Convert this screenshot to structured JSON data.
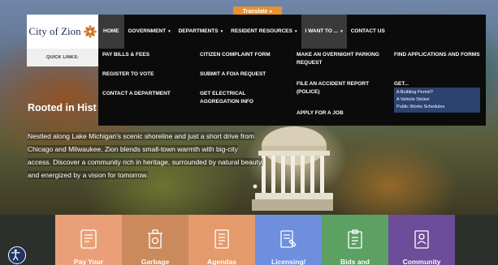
{
  "translate": {
    "label": "Translate »"
  },
  "logo": {
    "text": "City of Zion"
  },
  "quick_links": {
    "label": "QUICK LINKS:"
  },
  "nav": {
    "items": [
      {
        "label": "HOME",
        "caret": ""
      },
      {
        "label": "GOVERNMENT",
        "caret": "▾"
      },
      {
        "label": "DEPARTMENTS",
        "caret": "▾"
      },
      {
        "label": "RESIDENT RESOURCES",
        "caret": "▾"
      },
      {
        "label": "I WANT TO ...",
        "caret": "▾"
      },
      {
        "label": "CONTACT US",
        "caret": ""
      }
    ]
  },
  "dropdown": {
    "col1": [
      "PAY BILLS & FEES",
      "REGISTER TO VOTE",
      "CONTACT A DEPARTMENT"
    ],
    "col2": [
      "CITIZEN COMPLAINT FORM",
      "SUBMIT A FOIA REQUEST",
      "GET ELECTRICAL AGGREGATION INFO"
    ],
    "col3": [
      "MAKE AN OVERNIGHT PARKING REQUEST",
      "FILE AN ACCIDENT REPORT (POLICE)",
      "APPLY FOR A JOB"
    ],
    "col4": [
      "FIND APPLICATIONS AND FORMS",
      "GET..."
    ],
    "get_list": [
      "A Building Permit?",
      "A Vehicle Sticker",
      "Public Works Schedules"
    ]
  },
  "hero": {
    "title": "Rooted in Hist",
    "body": "Nestled along Lake Michigan's scenic shoreline and just a short drive from Chicago and Milwaukee, Zion blends small-town warmth with big-city access. Discover a community rich in heritage, surrounded by natural beauty, and energized by a vision for tomorrow."
  },
  "tiles": [
    {
      "label": "Pay Your",
      "color": "#e9a079",
      "icon": "bill-icon"
    },
    {
      "label": "Garbage",
      "color": "#cb8a5c",
      "icon": "recycle-bin-icon"
    },
    {
      "label": "Agendas",
      "color": "#e49a6a",
      "icon": "document-icon"
    },
    {
      "label": "Licensing/",
      "color": "#6e8fde",
      "icon": "license-icon"
    },
    {
      "label": "Bids and",
      "color": "#5da064",
      "icon": "clipboard-icon"
    },
    {
      "label": "Community",
      "color": "#6d4c99",
      "icon": "community-icon"
    }
  ]
}
